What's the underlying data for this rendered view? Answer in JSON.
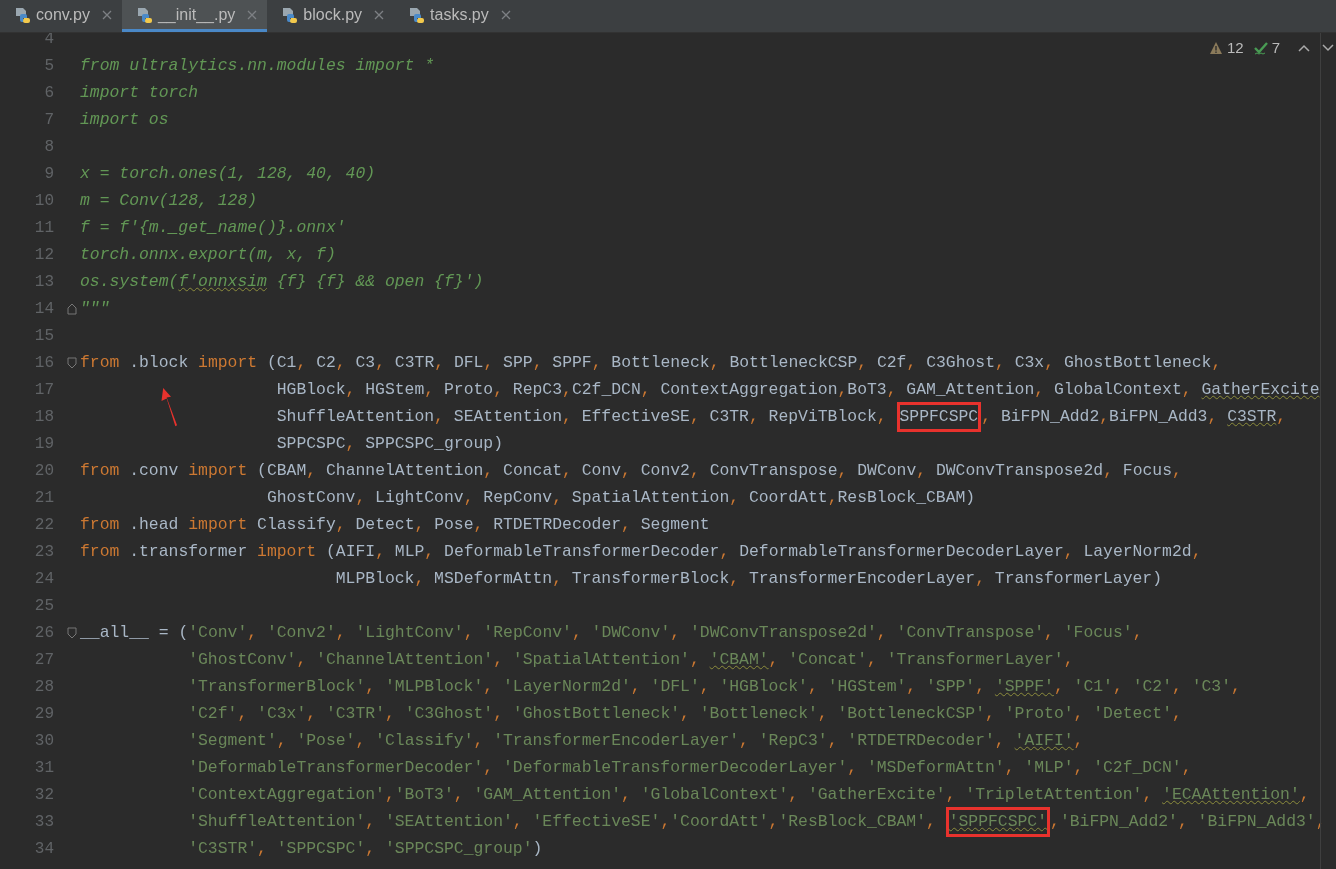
{
  "tabs": [
    {
      "label": "conv.py",
      "selected": false
    },
    {
      "label": "__init__.py",
      "selected": true
    },
    {
      "label": "block.py",
      "selected": false
    },
    {
      "label": "tasks.py",
      "selected": false
    }
  ],
  "inspections": {
    "warnings": "12",
    "weak_warnings": "7"
  },
  "lines": [
    {
      "number": "4"
    },
    {
      "number": "5",
      "segments": [
        {
          "kind": "doc",
          "t": "from ultralytics.nn.modules import *"
        }
      ]
    },
    {
      "number": "6",
      "segments": [
        {
          "kind": "doc",
          "t": "import torch"
        }
      ]
    },
    {
      "number": "7",
      "segments": [
        {
          "kind": "doc",
          "t": "import os"
        }
      ]
    },
    {
      "number": "8"
    },
    {
      "number": "9",
      "segments": [
        {
          "kind": "doc",
          "t": "x = torch.ones(1, 128, 40, 40)"
        }
      ]
    },
    {
      "number": "10",
      "segments": [
        {
          "kind": "doc",
          "t": "m = Conv(128, 128)"
        }
      ]
    },
    {
      "number": "11",
      "segments": [
        {
          "kind": "doc",
          "t": "f = f'{m._get_name()}.onnx'"
        }
      ]
    },
    {
      "number": "12",
      "segments": [
        {
          "kind": "doc",
          "t": "torch.onnx.export(m, x, f)"
        }
      ]
    },
    {
      "number": "13",
      "segments": [
        {
          "kind": "doc",
          "t": "os.system("
        },
        {
          "kind": "doc",
          "t": "f'onnxsim",
          "wavy": true
        },
        {
          "kind": "doc",
          "t": " {f} {f} && open {f}')"
        }
      ]
    },
    {
      "number": "14",
      "fold_end": true,
      "segments": [
        {
          "kind": "doc",
          "t": "\"\"\""
        }
      ]
    },
    {
      "number": "15"
    },
    {
      "number": "16",
      "fold_start": true,
      "segments": [
        {
          "kind": "kw",
          "t": "from"
        },
        {
          "kind": "code",
          "t": " .block "
        },
        {
          "kind": "kw",
          "t": "import"
        },
        {
          "kind": "code",
          "t": " (C1, C2, C3, C3TR, DFL, SPP, SPPF, Bottleneck, BottleneckCSP, C2f, C3Ghost, C3x, GhostBottleneck,"
        }
      ]
    },
    {
      "number": "17",
      "segments": [
        {
          "kind": "code",
          "t": "                    HGBlock, HGStem, Proto, RepC3,C2f_DCN, ContextAggregation,BoT3, GAM_Attention, GlobalContext, "
        },
        {
          "kind": "code",
          "t": "GatherExcite",
          "wavy": true
        }
      ]
    },
    {
      "number": "18",
      "segments": [
        {
          "kind": "code",
          "t": "                    ShuffleAttention, SEAttention, EffectiveSE, C3TR, RepViTBlock, "
        },
        {
          "kind": "code",
          "t": "SPPFCSPC",
          "boxed": true
        },
        {
          "kind": "code",
          "t": ", BiFPN_Add2,BiFPN_Add3, "
        },
        {
          "kind": "code",
          "t": "C3STR",
          "wavy": true
        },
        {
          "kind": "code",
          "t": ","
        }
      ]
    },
    {
      "number": "19",
      "segments": [
        {
          "kind": "code",
          "t": "                    SPPCSPC, SPPCSPC_group)"
        }
      ]
    },
    {
      "number": "20",
      "segments": [
        {
          "kind": "kw",
          "t": "from"
        },
        {
          "kind": "code",
          "t": " .conv "
        },
        {
          "kind": "kw",
          "t": "import"
        },
        {
          "kind": "code",
          "t": " (CBAM, ChannelAttention, Concat, Conv, Conv2, ConvTranspose, DWConv, DWConvTranspose2d, Focus,"
        }
      ]
    },
    {
      "number": "21",
      "segments": [
        {
          "kind": "code",
          "t": "                   GhostConv, LightConv, RepConv, SpatialAttention, CoordAtt,ResBlock_CBAM)"
        }
      ]
    },
    {
      "number": "22",
      "segments": [
        {
          "kind": "kw",
          "t": "from"
        },
        {
          "kind": "code",
          "t": " .head "
        },
        {
          "kind": "kw",
          "t": "import"
        },
        {
          "kind": "code",
          "t": " Classify, Detect, Pose, RTDETRDecoder, Segment"
        }
      ]
    },
    {
      "number": "23",
      "segments": [
        {
          "kind": "kw",
          "t": "from"
        },
        {
          "kind": "code",
          "t": " .transformer "
        },
        {
          "kind": "kw",
          "t": "import"
        },
        {
          "kind": "code",
          "t": " (AIFI, MLP, DeformableTransformerDecoder, DeformableTransformerDecoderLayer, LayerNorm2d,"
        }
      ]
    },
    {
      "number": "24",
      "segments": [
        {
          "kind": "code",
          "t": "                          MLPBlock, MSDeformAttn, TransformerBlock, TransformerEncoderLayer, TransformerLayer)"
        }
      ]
    },
    {
      "number": "25"
    },
    {
      "number": "26",
      "fold_start": true,
      "segments": [
        {
          "kind": "code",
          "t": "__all__ = "
        },
        {
          "kind": "str",
          "t": "('Conv', 'Conv2', 'LightConv', 'RepConv', 'DWConv', 'DWConvTranspose2d', 'ConvTranspose', 'Focus',"
        }
      ]
    },
    {
      "number": "27",
      "segments": [
        {
          "kind": "str",
          "t": "           'GhostConv', 'ChannelAttention', 'SpatialAttention', "
        },
        {
          "kind": "str",
          "t": "'CBAM'",
          "wavy": true
        },
        {
          "kind": "str",
          "t": ", 'Concat', 'TransformerLayer',"
        }
      ]
    },
    {
      "number": "28",
      "segments": [
        {
          "kind": "str",
          "t": "           'TransformerBlock', 'MLPBlock', 'LayerNorm2d', 'DFL', 'HGBlock', 'HGStem', 'SPP', "
        },
        {
          "kind": "str",
          "t": "'SPPF'",
          "wavy": true
        },
        {
          "kind": "str",
          "t": ", 'C1', 'C2', 'C3',"
        }
      ]
    },
    {
      "number": "29",
      "segments": [
        {
          "kind": "str",
          "t": "           'C2f', 'C3x', 'C3TR', 'C3Ghost', 'GhostBottleneck', 'Bottleneck', 'BottleneckCSP', 'Proto', 'Detect',"
        }
      ]
    },
    {
      "number": "30",
      "segments": [
        {
          "kind": "str",
          "t": "           'Segment', 'Pose', 'Classify', 'TransformerEncoderLayer', 'RepC3', 'RTDETRDecoder', "
        },
        {
          "kind": "str",
          "t": "'AIFI'",
          "wavy": true
        },
        {
          "kind": "str",
          "t": ","
        }
      ]
    },
    {
      "number": "31",
      "segments": [
        {
          "kind": "str",
          "t": "           'DeformableTransformerDecoder', 'DeformableTransformerDecoderLayer', 'MSDeformAttn', 'MLP', 'C2f_DCN',"
        }
      ]
    },
    {
      "number": "32",
      "segments": [
        {
          "kind": "str",
          "t": "           'ContextAggregation','BoT3', 'GAM_Attention', 'GlobalContext', 'GatherExcite', 'TripletAttention', "
        },
        {
          "kind": "str",
          "t": "'ECAAttention'",
          "wavy": true
        },
        {
          "kind": "str",
          "t": ","
        }
      ]
    },
    {
      "number": "33",
      "segments": [
        {
          "kind": "str",
          "t": "           'ShuffleAttention', 'SEAttention', 'EffectiveSE','CoordAtt','ResBlock_CBAM', "
        },
        {
          "kind": "str",
          "t": "'SPPFCSPC'",
          "boxed": true,
          "wavy": true
        },
        {
          "kind": "str",
          "t": ",'BiFPN_Add2', 'BiFPN_Add3',"
        }
      ]
    },
    {
      "number": "34",
      "segments": [
        {
          "kind": "str",
          "t": "           'C3STR', 'SPPCSPC', 'SPPCSPC_group')"
        }
      ]
    }
  ]
}
